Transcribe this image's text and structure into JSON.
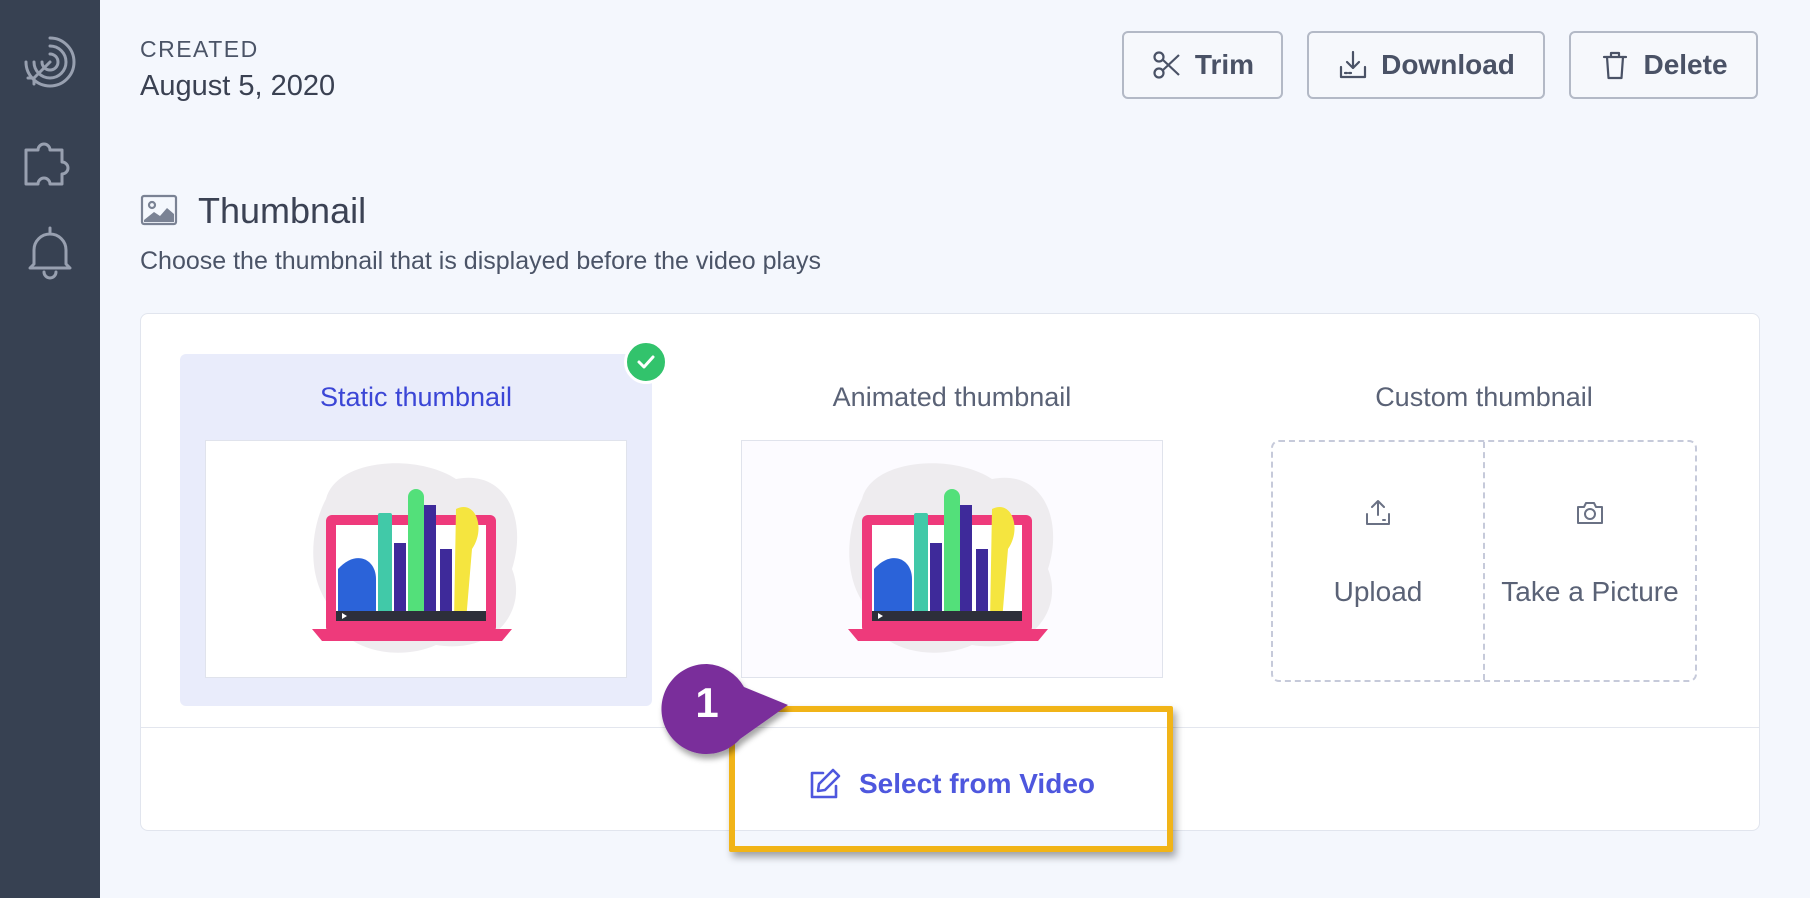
{
  "sidebar": {
    "items": [
      {
        "name": "target-arrow-icon"
      },
      {
        "name": "puzzle-icon"
      },
      {
        "name": "bell-icon"
      }
    ]
  },
  "header": {
    "created_label": "CREATED",
    "created_date": "August 5, 2020",
    "buttons": {
      "trim": "Trim",
      "download": "Download",
      "delete": "Delete"
    }
  },
  "thumbnail_section": {
    "title": "Thumbnail",
    "subtitle": "Choose the thumbnail that is displayed before the video plays",
    "options": {
      "static": "Static thumbnail",
      "animated": "Animated thumbnail",
      "custom": "Custom thumbnail"
    },
    "custom_actions": {
      "upload": "Upload",
      "take_picture": "Take a Picture"
    },
    "select_from_video": "Select from Video"
  },
  "annotation": {
    "step_number": "1"
  },
  "colors": {
    "sidebar": "#374152",
    "accent": "#4e57de",
    "check": "#32c36c",
    "highlight": "#f1b418",
    "callout": "#7a2f9b"
  }
}
